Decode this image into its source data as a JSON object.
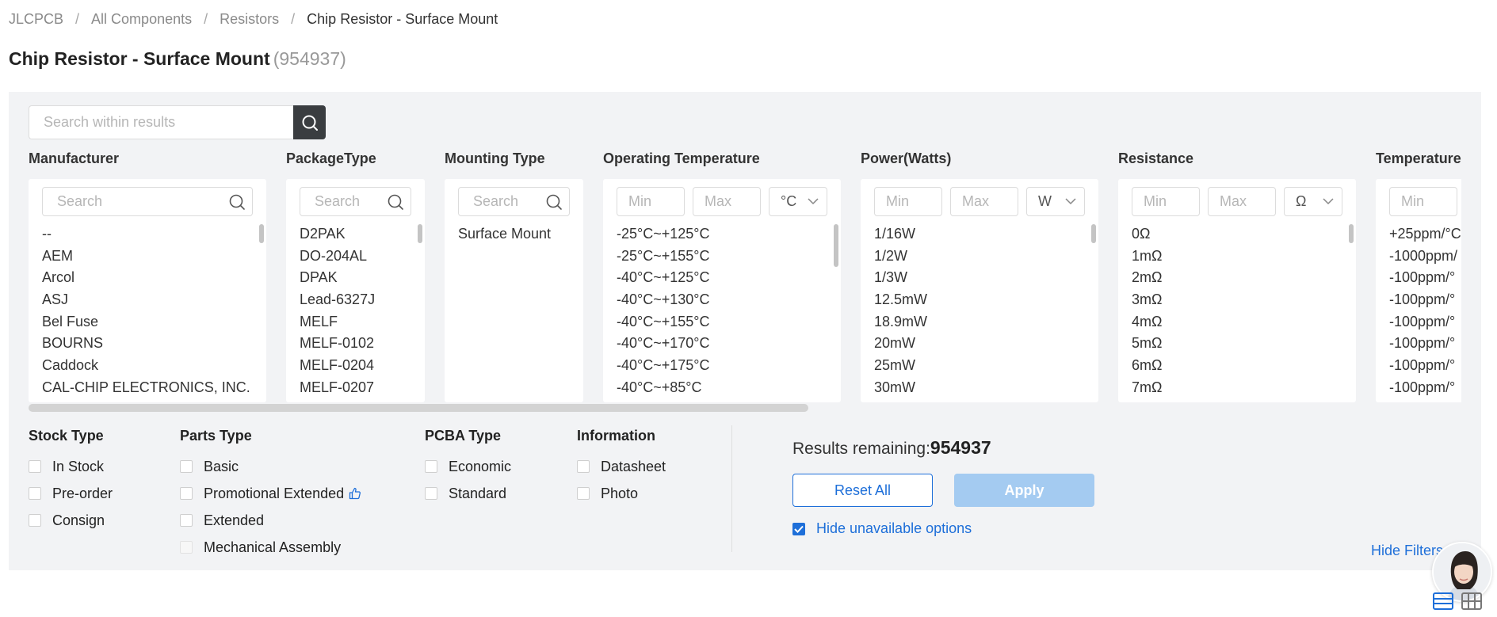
{
  "breadcrumb": {
    "items": [
      "JLCPCB",
      "All Components",
      "Resistors"
    ],
    "current": "Chip Resistor - Surface Mount",
    "separator": "/"
  },
  "title": {
    "text": "Chip Resistor - Surface Mount",
    "count": "(954937)"
  },
  "search": {
    "placeholder": "Search within results",
    "icon": "search-icon"
  },
  "filters": {
    "manufacturer": {
      "label": "Manufacturer",
      "search_placeholder": "Search",
      "options": [
        "--",
        "AEM",
        "Arcol",
        "ASJ",
        "Bel Fuse",
        "BOURNS",
        "Caddock",
        "CAL-CHIP ELECTRONICS, INC."
      ]
    },
    "package_type": {
      "label": "PackageType",
      "search_placeholder": "Search",
      "options": [
        "D2PAK",
        "DO-204AL",
        "DPAK",
        "Lead-6327J",
        "MELF",
        "MELF-0102",
        "MELF-0204",
        "MELF-0207"
      ]
    },
    "mounting_type": {
      "label": "Mounting Type",
      "search_placeholder": "Search",
      "options": [
        "Surface Mount"
      ]
    },
    "operating_temperature": {
      "label": "Operating Temperature",
      "min_placeholder": "Min",
      "max_placeholder": "Max",
      "unit": "°C",
      "options": [
        "-25°C~+125°C",
        "-25°C~+155°C",
        "-40°C~+125°C",
        "-40°C~+130°C",
        "-40°C~+155°C",
        "-40°C~+170°C",
        "-40°C~+175°C",
        "-40°C~+85°C"
      ]
    },
    "power": {
      "label": "Power(Watts)",
      "min_placeholder": "Min",
      "max_placeholder": "Max",
      "unit": "W",
      "options": [
        "1/16W",
        "1/2W",
        "1/3W",
        "12.5mW",
        "18.9mW",
        "20mW",
        "25mW",
        "30mW"
      ]
    },
    "resistance": {
      "label": "Resistance",
      "min_placeholder": "Min",
      "max_placeholder": "Max",
      "unit": "Ω",
      "options": [
        "0Ω",
        "1mΩ",
        "2mΩ",
        "3mΩ",
        "4mΩ",
        "5mΩ",
        "6mΩ",
        "7mΩ"
      ]
    },
    "temperature_coefficient": {
      "label": "Temperature",
      "min_placeholder": "Min",
      "options": [
        "+25ppm/°C",
        "-1000ppm/",
        "-100ppm/°",
        "-100ppm/°",
        "-100ppm/°",
        "-100ppm/°",
        "-100ppm/°",
        "-100ppm/°"
      ]
    }
  },
  "checkbox_groups": {
    "stock_type": {
      "label": "Stock Type",
      "options": [
        "In Stock",
        "Pre-order",
        "Consign"
      ]
    },
    "parts_type": {
      "label": "Parts Type",
      "options": [
        "Basic",
        "Promotional Extended",
        "Extended",
        "Mechanical Assembly"
      ]
    },
    "pcba_type": {
      "label": "PCBA Type",
      "options": [
        "Economic",
        "Standard"
      ]
    },
    "information": {
      "label": "Information",
      "options": [
        "Datasheet",
        "Photo"
      ]
    }
  },
  "results": {
    "label": "Results remaining:",
    "count": "954937",
    "reset_label": "Reset All",
    "apply_label": "Apply",
    "hide_unavailable_label": "Hide unavailable options",
    "hide_unavailable_checked": true
  },
  "hide_filters_label": "Hide Filters",
  "colors": {
    "accent": "#1e6fd9",
    "apply_disabled": "#a4cbf1",
    "panel_bg": "#f2f3f5",
    "search_btn": "#3a3d40"
  }
}
